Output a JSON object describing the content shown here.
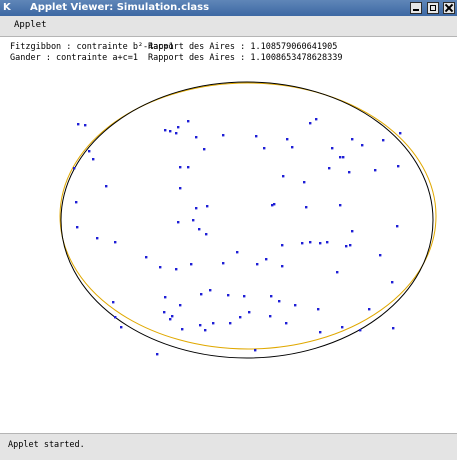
{
  "window": {
    "title": "Applet Viewer: Simulation.class",
    "icon_glyph": "K",
    "buttons": [
      "minimize",
      "maximize",
      "close"
    ]
  },
  "menubar": {
    "items": [
      "Applet"
    ]
  },
  "info": {
    "rows": [
      {
        "label": "Fitzgibbon : contrainte b²-4ac=1",
        "result": "Rapport des Aires : 1.108579060641905"
      },
      {
        "label": "Gander : contrainte a+c=1",
        "result": "Rapport des Aires : 1.1008653478628339"
      }
    ]
  },
  "status": {
    "text": "Applet started."
  },
  "colors": {
    "points": "#1f1fd6",
    "fitzgibbon_ellipse": "#000000",
    "gander_ellipse": "#e0a800"
  }
}
